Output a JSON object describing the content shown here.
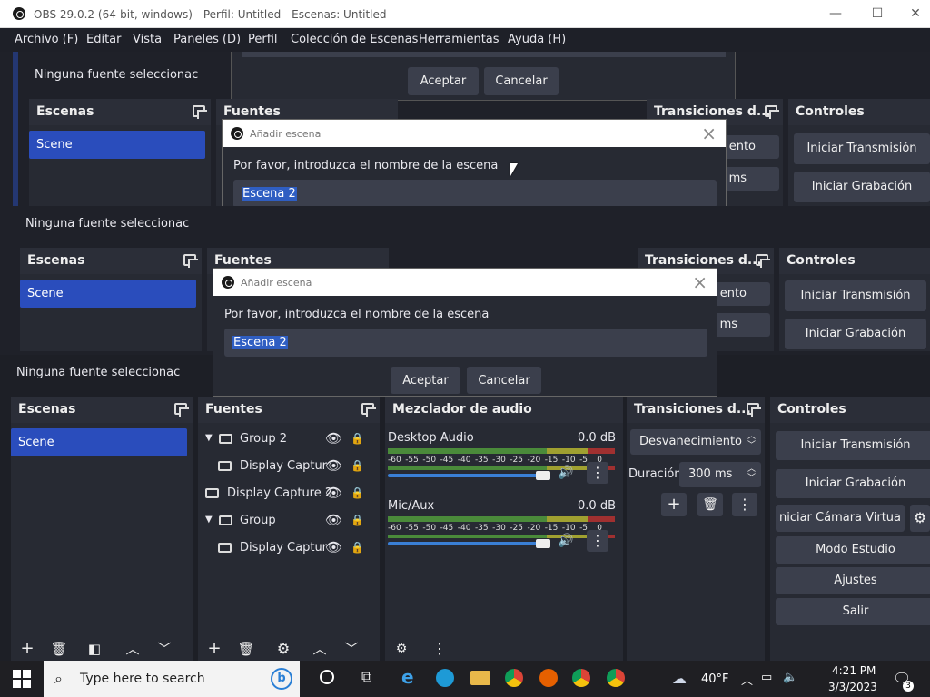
{
  "window": {
    "title": "OBS 29.0.2 (64-bit, windows) - Perfil: Untitled - Escenas: Untitled",
    "min": "—",
    "max": "☐",
    "close": "✕"
  },
  "menu": [
    "Archivo (F)",
    "Editar",
    "Vista",
    "Paneles (D)",
    "Perfil",
    "Colección de Escenas",
    "Herramientas",
    "Ayuda (H)"
  ],
  "no_source": "Ninguna fuente seleccionac",
  "docks": {
    "scenes": "Escenas",
    "sources": "Fuentes",
    "mixer": "Mezclador de audio",
    "transitions": "Transiciones d...",
    "controls": "Controles"
  },
  "scene_item": "Scene",
  "sources": [
    {
      "label": "Group 2",
      "kind": "group",
      "indent": false
    },
    {
      "label": "Display Captur",
      "kind": "display",
      "indent": true
    },
    {
      "label": "Display Capture 2",
      "kind": "display",
      "indent": false
    },
    {
      "label": "Group",
      "kind": "group",
      "indent": false
    },
    {
      "label": "Display Captur",
      "kind": "display",
      "indent": true
    }
  ],
  "mixer": {
    "channels": [
      {
        "name": "Desktop Audio",
        "db": "0.0 dB"
      },
      {
        "name": "Mic/Aux",
        "db": "0.0 dB"
      }
    ],
    "scale": [
      "-60",
      "-55",
      "-50",
      "-45",
      "-40",
      "-35",
      "-30",
      "-25",
      "-20",
      "-15",
      "-10",
      "-5",
      "0"
    ]
  },
  "transitions": {
    "type": "Desvanecimiento",
    "type_short": "ento",
    "duration_label": "Duración",
    "duration": "300 ms",
    "duration_short": "ms"
  },
  "controls": {
    "start_stream": "Iniciar Transmisión",
    "start_record": "Iniciar Grabación",
    "virtual_cam": "niciar Cámara Virtua",
    "studio_mode": "Modo Estudio",
    "settings": "Ajustes",
    "exit": "Salir"
  },
  "dialog": {
    "title": "Añadir escena",
    "prompt": "Por favor, introduzca el nombre de la escena",
    "value": "Escena 2",
    "ok": "Aceptar",
    "cancel": "Cancelar"
  },
  "taskbar": {
    "search_placeholder": "Type here to search",
    "weather": "40°F",
    "time": "4:21 PM",
    "date": "3/3/2023",
    "notification_count": "3"
  },
  "colors": {
    "accent": "#2a4dbc",
    "panel": "#272a33",
    "meter_green": "#4a8a3a",
    "meter_yellow": "#a0a030",
    "meter_red": "#a03030",
    "slider": "#3a7fd5"
  }
}
